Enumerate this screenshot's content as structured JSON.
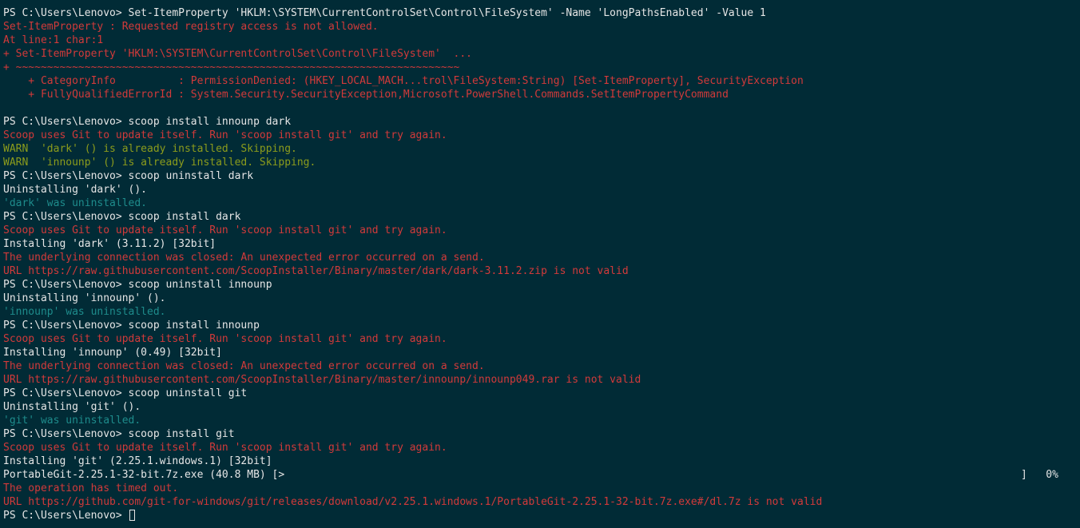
{
  "terminal": {
    "colors": {
      "background": "#012b36",
      "normal": "#e6e6e6",
      "error": "#d23a3a",
      "warn": "#8c9c1c",
      "info": "#1e8c8c"
    },
    "lines": [
      {
        "type": "normal",
        "text": "PS C:\\Users\\Lenovo> Set-ItemProperty 'HKLM:\\SYSTEM\\CurrentControlSet\\Control\\FileSystem' -Name 'LongPathsEnabled' -Value 1"
      },
      {
        "type": "error",
        "text": "Set-ItemProperty : Requested registry access is not allowed."
      },
      {
        "type": "error",
        "text": "At line:1 char:1"
      },
      {
        "type": "error",
        "text": "+ Set-ItemProperty 'HKLM:\\SYSTEM\\CurrentControlSet\\Control\\FileSystem'  ..."
      },
      {
        "type": "error",
        "text": "+ ~~~~~~~~~~~~~~~~~~~~~~~~~~~~~~~~~~~~~~~~~~~~~~~~~~~~~~~~~~~~~~~~~~~~~~~"
      },
      {
        "type": "error",
        "text": "    + CategoryInfo          : PermissionDenied: (HKEY_LOCAL_MACH...trol\\FileSystem:String) [Set-ItemProperty], SecurityException"
      },
      {
        "type": "error",
        "text": "    + FullyQualifiedErrorId : System.Security.SecurityException,Microsoft.PowerShell.Commands.SetItemPropertyCommand"
      },
      {
        "type": "normal",
        "text": ""
      },
      {
        "type": "normal",
        "text": "PS C:\\Users\\Lenovo> scoop install innounp dark"
      },
      {
        "type": "error",
        "text": "Scoop uses Git to update itself. Run 'scoop install git' and try again."
      },
      {
        "type": "warn",
        "text": "WARN  'dark' () is already installed. Skipping."
      },
      {
        "type": "warn",
        "text": "WARN  'innounp' () is already installed. Skipping."
      },
      {
        "type": "normal",
        "text": "PS C:\\Users\\Lenovo> scoop uninstall dark"
      },
      {
        "type": "normal",
        "text": "Uninstalling 'dark' ()."
      },
      {
        "type": "info",
        "text": "'dark' was uninstalled."
      },
      {
        "type": "normal",
        "text": "PS C:\\Users\\Lenovo> scoop install dark"
      },
      {
        "type": "error",
        "text": "Scoop uses Git to update itself. Run 'scoop install git' and try again."
      },
      {
        "type": "normal",
        "text": "Installing 'dark' (3.11.2) [32bit]"
      },
      {
        "type": "error",
        "text": "The underlying connection was closed: An unexpected error occurred on a send."
      },
      {
        "type": "error",
        "text": "URL https://raw.githubusercontent.com/ScoopInstaller/Binary/master/dark/dark-3.11.2.zip is not valid"
      },
      {
        "type": "normal",
        "text": "PS C:\\Users\\Lenovo> scoop uninstall innounp"
      },
      {
        "type": "normal",
        "text": "Uninstalling 'innounp' ()."
      },
      {
        "type": "info",
        "text": "'innounp' was uninstalled."
      },
      {
        "type": "normal",
        "text": "PS C:\\Users\\Lenovo> scoop install innounp"
      },
      {
        "type": "error",
        "text": "Scoop uses Git to update itself. Run 'scoop install git' and try again."
      },
      {
        "type": "normal",
        "text": "Installing 'innounp' (0.49) [32bit]"
      },
      {
        "type": "error",
        "text": "The underlying connection was closed: An unexpected error occurred on a send."
      },
      {
        "type": "error",
        "text": "URL https://raw.githubusercontent.com/ScoopInstaller/Binary/master/innounp/innounp049.rar is not valid"
      },
      {
        "type": "normal",
        "text": "PS C:\\Users\\Lenovo> scoop uninstall git"
      },
      {
        "type": "normal",
        "text": "Uninstalling 'git' ()."
      },
      {
        "type": "info",
        "text": "'git' was uninstalled."
      },
      {
        "type": "normal",
        "text": "PS C:\\Users\\Lenovo> scoop install git"
      },
      {
        "type": "error",
        "text": "Scoop uses Git to update itself. Run 'scoop install git' and try again."
      },
      {
        "type": "normal",
        "text": "Installing 'git' (2.25.1.windows.1) [32bit]"
      },
      {
        "type": "normal",
        "text": "PortableGit-2.25.1-32-bit.7z.exe (40.8 MB) [>",
        "progress_end": "]   0%"
      },
      {
        "type": "error",
        "text": "The operation has timed out."
      },
      {
        "type": "error",
        "text": "URL https://github.com/git-for-windows/git/releases/download/v2.25.1.windows.1/PortableGit-2.25.1-32-bit.7z.exe#/dl.7z is not valid"
      },
      {
        "type": "prompt",
        "text": "PS C:\\Users\\Lenovo> "
      }
    ],
    "download_progress_percent": 0,
    "cursor_icon": "block-cursor"
  }
}
